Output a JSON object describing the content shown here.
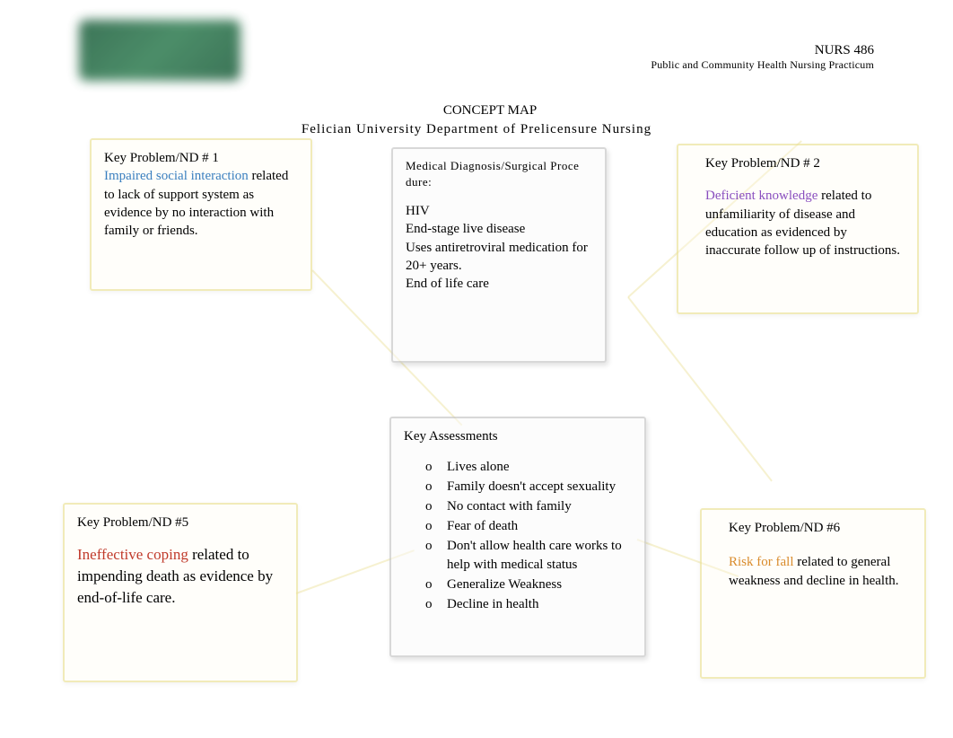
{
  "header": {
    "course_code": "NURS 486",
    "course_name": "Public and Community Health Nursing Practicum"
  },
  "title": {
    "line1": "CONCEPT MAP",
    "line2": "Felician University Department of Prelicensure Nursing"
  },
  "nd1": {
    "label": "Key Problem/ND # 1",
    "highlight": "Impaired social interaction",
    "body": " related to lack of support system as evidence by no interaction with family or friends."
  },
  "med": {
    "label": "Medical Diagnosis/Surgical Proce   dure:",
    "line1": "HIV",
    "line2": "End-stage live disease",
    "line3": "Uses antiretroviral medication for 20+ years.",
    "line4": "End of life care"
  },
  "nd2": {
    "label": "Key Problem/ND # 2",
    "highlight": "Deficient knowledge",
    "body": " related to unfamiliarity of disease and education as evidenced by inaccurate follow up of instructions."
  },
  "ka": {
    "label": "Key Assessments",
    "items": [
      "Lives alone",
      "Family doesn't accept sexuality",
      "No contact with family",
      "Fear of death",
      "Don't allow health care works to help with medical status",
      "Generalize Weakness",
      "Decline  in health"
    ]
  },
  "nd5": {
    "label": "Key Problem/ND #5",
    "highlight": "Ineffective coping",
    "body": " related to impending death as evidence by end-of-life care."
  },
  "nd6": {
    "label": "Key Problem/ND #6",
    "highlight": "Risk for fall",
    "body": " related to general weakness and decline in health."
  }
}
